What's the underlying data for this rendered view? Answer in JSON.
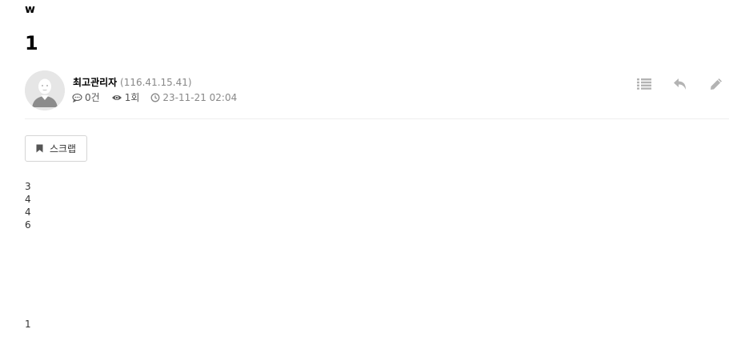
{
  "post": {
    "category": "w",
    "title": "1",
    "author": {
      "name": "최고관리자",
      "ip": "(116.41.15.41)"
    },
    "meta": {
      "comments": "0건",
      "views": "1회",
      "date": "23-11-21 02:04"
    },
    "scrap_label": "스크랩",
    "content_lines": [
      "3",
      "4",
      "4",
      "6"
    ],
    "footer_line": "1"
  },
  "icons": {
    "list": "list-icon",
    "reply": "reply-icon",
    "edit": "pencil-icon",
    "comment": "comment-icon",
    "view": "eye-icon",
    "clock": "clock-icon",
    "bookmark": "bookmark-icon"
  },
  "colors": {
    "icon_gray": "#b3b3b3",
    "divider": "#eeeeee",
    "button_border": "#d5d5d5"
  }
}
